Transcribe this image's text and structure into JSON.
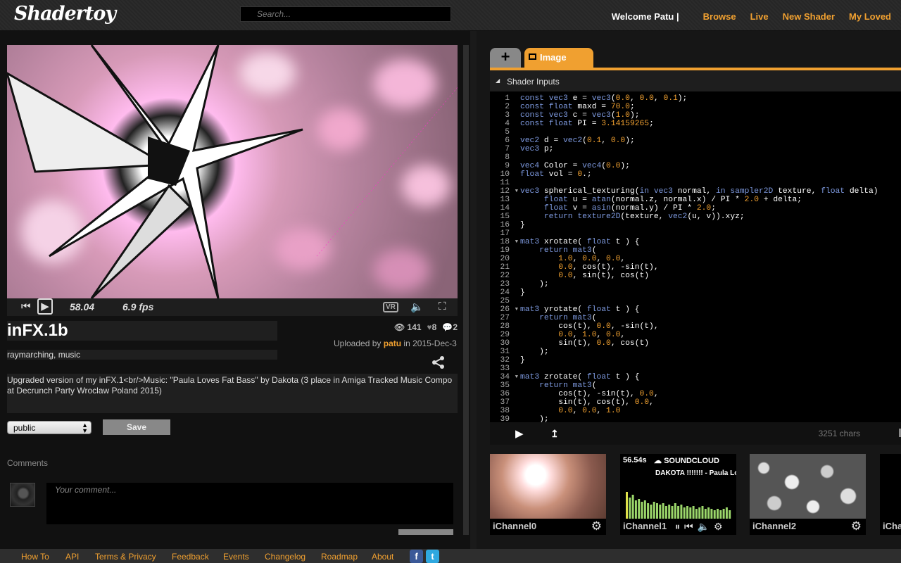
{
  "header": {
    "logo": "Shadertoy",
    "search_placeholder": "Search...",
    "welcome": "Welcome Patu |",
    "nav": [
      "Browse",
      "Live",
      "New Shader",
      "My Loved"
    ]
  },
  "player": {
    "time": "58.04",
    "fps": "6.9 fps"
  },
  "shader": {
    "title": "inFX.1b",
    "tags": "raymarching, music",
    "views": "141",
    "likes": "8",
    "comments_count": "2",
    "uploaded_prefix": "Uploaded by",
    "uploaded_user": "patu",
    "uploaded_suffix": "in 2015-Dec-3",
    "description": "Upgraded version of my inFX.1<br/>Music: \"Paula Loves Fat Bass\" by Dakota (3 place in Amiga Tracked Music Compo at Decrunch Party Wroclaw Poland 2015)",
    "visibility": "public",
    "save_label": "Save"
  },
  "comments": {
    "label": "Comments",
    "placeholder": "Your comment..."
  },
  "editor": {
    "tab_add": "+",
    "tab_image": "Image",
    "inputs_label": "Shader Inputs",
    "chars": "3251 chars",
    "line_numbers": [
      "1",
      "2",
      "3",
      "4",
      "5",
      "6",
      "7",
      "8",
      "9",
      "10",
      "11",
      "12",
      "13",
      "14",
      "15",
      "16",
      "17",
      "18",
      "19",
      "20",
      "21",
      "22",
      "23",
      "24",
      "25",
      "26",
      "27",
      "28",
      "29",
      "30",
      "31",
      "32",
      "33",
      "34",
      "35",
      "36",
      "37",
      "38",
      "39"
    ],
    "fold_lines": [
      12,
      18,
      26,
      34
    ],
    "code": [
      "const vec3 e = vec3(0.0, 0.0, 0.1);",
      "const float maxd = 70.0;",
      "const vec3 c = vec3(1.0);",
      "const float PI = 3.14159265;",
      "",
      "vec2 d = vec2(0.1, 0.0);",
      "vec3 p;",
      "",
      "vec4 Color = vec4(0.0);",
      "float vol = 0.;",
      "",
      "vec3 spherical_texturing(in vec3 normal, in sampler2D texture, float delta)",
      "     float u = atan(normal.z, normal.x) / PI * 2.0 + delta;",
      "     float v = asin(normal.y) / PI * 2.0;",
      "     return texture2D(texture, vec2(u, v)).xyz;",
      "}",
      "",
      "mat3 xrotate( float t ) {",
      "    return mat3(",
      "        1.0, 0.0, 0.0,",
      "        0.0, cos(t), -sin(t),",
      "        0.0, sin(t), cos(t)",
      "    );",
      "}",
      "",
      "mat3 yrotate( float t ) {",
      "    return mat3(",
      "        cos(t), 0.0, -sin(t),",
      "        0.0, 1.0, 0.0,",
      "        sin(t), 0.0, cos(t)",
      "    );",
      "}",
      "",
      "mat3 zrotate( float t ) {",
      "    return mat3(",
      "        cos(t), -sin(t), 0.0,",
      "        sin(t), cos(t), 0.0,",
      "        0.0, 0.0, 1.0",
      "    );"
    ]
  },
  "channels": [
    {
      "name": "iChannel0"
    },
    {
      "name": "iChannel1",
      "time": "56.54s",
      "source": "SOUNDCLOUD",
      "track": "DAKOTA !!!!!!! - Paula Loves Fat Bass"
    },
    {
      "name": "iChannel2"
    },
    {
      "name": "iCha"
    }
  ],
  "footer": {
    "links": [
      "How To",
      "API",
      "Terms & Privacy",
      "Feedback",
      "Events",
      "Changelog",
      "Roadmap",
      "About"
    ],
    "facebook": "f",
    "twitter": "t"
  },
  "colors": {
    "accent": "#f0a030",
    "keyword": "#7e9ae0",
    "number": "#f0a030"
  }
}
